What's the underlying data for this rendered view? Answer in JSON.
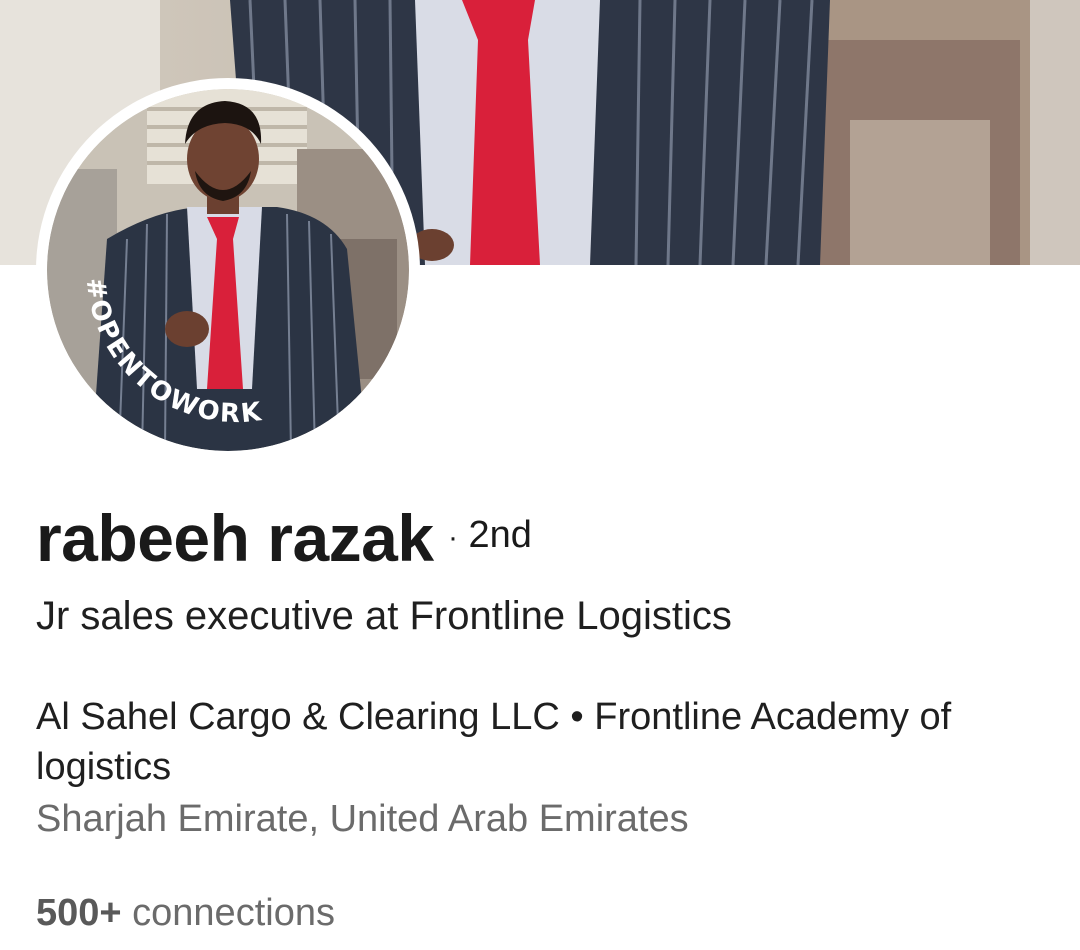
{
  "profile": {
    "name": "rabeeh razak",
    "degree_separator": "·",
    "degree": "2nd",
    "headline": "Jr sales executive at Frontline Logistics",
    "experience": "Al Sahel Cargo & Clearing LLC • Frontline Academy of logistics",
    "location": "Sharjah Emirate, United Arab Emirates",
    "connections_count": "500+",
    "connections_label": "connections",
    "open_to_work_badge": "#OPENTOWORK"
  },
  "colors": {
    "open_to_work_green": "#3f7a35",
    "tie_red": "#d9203a",
    "suit_navy": "#2b3444",
    "text_primary": "#1a1a1a",
    "text_secondary": "#6b6b6b"
  },
  "icons": {
    "cover": "cover-photo",
    "avatar": "profile-photo"
  }
}
